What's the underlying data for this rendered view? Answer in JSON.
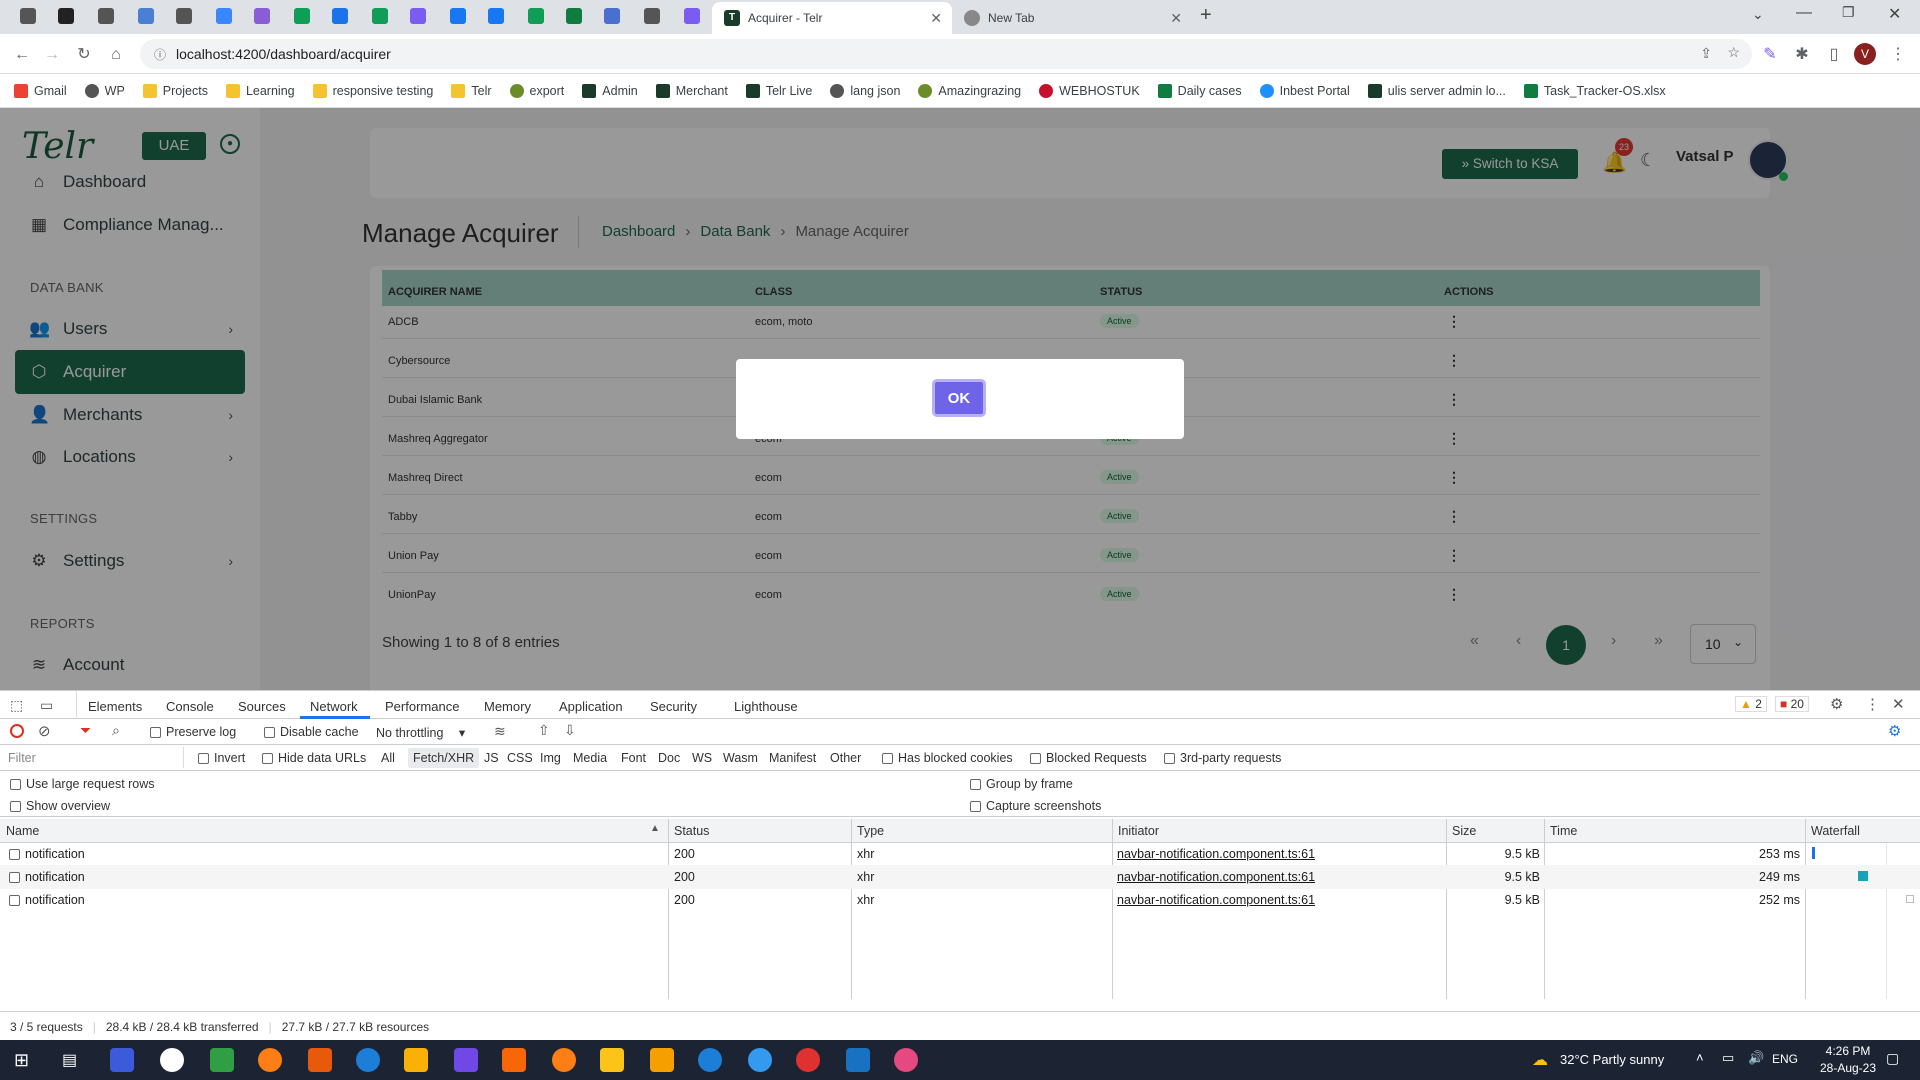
{
  "browser": {
    "tabs": [
      {
        "title": "Acquirer - Telr",
        "active": true
      },
      {
        "title": "New Tab",
        "active": false
      }
    ],
    "url": "localhost:4200/dashboard/acquirer",
    "bookmarks": [
      "Gmail",
      "WP",
      "Projects",
      "Learning",
      "responsive testing",
      "Telr",
      "export",
      "Admin",
      "Merchant",
      "Telr Live",
      "lang json",
      "Amazingrazing",
      "WEBHOSTUK",
      "Daily cases",
      "Inbest Portal",
      "ulis server admin lo...",
      "Task_Tracker-OS.xlsx"
    ]
  },
  "app": {
    "logo": "Telr",
    "region_badge": "UAE",
    "switch_button": "» Switch to KSA",
    "notification_count": "23",
    "user_name": "Vatsal P",
    "sidebar": {
      "items_top": [
        {
          "label": "Dashboard",
          "icon": "home-icon"
        },
        {
          "label": "Compliance Manag...",
          "icon": "compliance-icon"
        }
      ],
      "section_databank": "DATA BANK",
      "items_databank": [
        {
          "label": "Users",
          "icon": "users-icon"
        },
        {
          "label": "Acquirer",
          "icon": "cube-icon",
          "active": true
        },
        {
          "label": "Merchants",
          "icon": "merchant-icon"
        },
        {
          "label": "Locations",
          "icon": "globe-icon"
        }
      ],
      "section_settings": "SETTINGS",
      "settings_label": "Settings",
      "section_reports": "REPORTS",
      "account_label": "Account"
    },
    "page_title": "Manage Acquirer",
    "breadcrumb": [
      "Dashboard",
      "Data Bank",
      "Manage Acquirer"
    ],
    "table": {
      "headers": [
        "ACQUIRER NAME",
        "CLASS",
        "STATUS",
        "ACTIONS"
      ],
      "rows": [
        {
          "name": "ADCB",
          "class": "ecom, moto",
          "status": "Active"
        },
        {
          "name": "Cybersource",
          "class": "",
          "status": ""
        },
        {
          "name": "Dubai Islamic Bank",
          "class": "",
          "status": ""
        },
        {
          "name": "Mashreq Aggregator",
          "class": "ecom",
          "status": "Active"
        },
        {
          "name": "Mashreq Direct",
          "class": "ecom",
          "status": "Active"
        },
        {
          "name": "Tabby",
          "class": "ecom",
          "status": "Active"
        },
        {
          "name": "Union Pay",
          "class": "ecom",
          "status": "Active"
        },
        {
          "name": "UnionPay",
          "class": "ecom",
          "status": "Active"
        }
      ]
    },
    "entries_text": "Showing 1 to 8 of 8 entries",
    "current_page": "1",
    "page_size": "10",
    "modal_ok": "OK"
  },
  "devtools": {
    "tabs": [
      "Elements",
      "Console",
      "Sources",
      "Network",
      "Performance",
      "Memory",
      "Application",
      "Security",
      "Lighthouse"
    ],
    "warnings": "2",
    "errors": "20",
    "preserve_log": "Preserve log",
    "disable_cache": "Disable cache",
    "throttling": "No throttling",
    "filter_placeholder": "Filter",
    "invert": "Invert",
    "hide_data_urls": "Hide data URLs",
    "type_filters": [
      "All",
      "Fetch/XHR",
      "JS",
      "CSS",
      "Img",
      "Media",
      "Font",
      "Doc",
      "WS",
      "Wasm",
      "Manifest",
      "Other"
    ],
    "has_blocked_cookies": "Has blocked cookies",
    "blocked_requests": "Blocked Requests",
    "third_party": "3rd-party requests",
    "use_large_rows": "Use large request rows",
    "group_by_frame": "Group by frame",
    "show_overview": "Show overview",
    "capture_screenshots": "Capture screenshots",
    "columns": [
      "Name",
      "Status",
      "Type",
      "Initiator",
      "Size",
      "Time",
      "Waterfall"
    ],
    "requests": [
      {
        "name": "notification",
        "status": "200",
        "type": "xhr",
        "initiator": "navbar-notification.component.ts:61",
        "size": "9.5 kB",
        "time": "253 ms"
      },
      {
        "name": "notification",
        "status": "200",
        "type": "xhr",
        "initiator": "navbar-notification.component.ts:61",
        "size": "9.5 kB",
        "time": "249 ms"
      },
      {
        "name": "notification",
        "status": "200",
        "type": "xhr",
        "initiator": "navbar-notification.component.ts:61",
        "size": "9.5 kB",
        "time": "252 ms"
      }
    ],
    "status_bar": [
      "3 / 5 requests",
      "28.4 kB / 28.4 kB transferred",
      "27.7 kB / 27.7 kB resources"
    ]
  },
  "taskbar": {
    "weather": "32°C  Partly sunny",
    "lang": "ENG",
    "time": "4:26 PM",
    "date": "28-Aug-23"
  },
  "colors": {
    "accent_green": "#1d6b4f",
    "ok_purple": "#6f63e8",
    "header_teal": "#a7d3c8"
  }
}
